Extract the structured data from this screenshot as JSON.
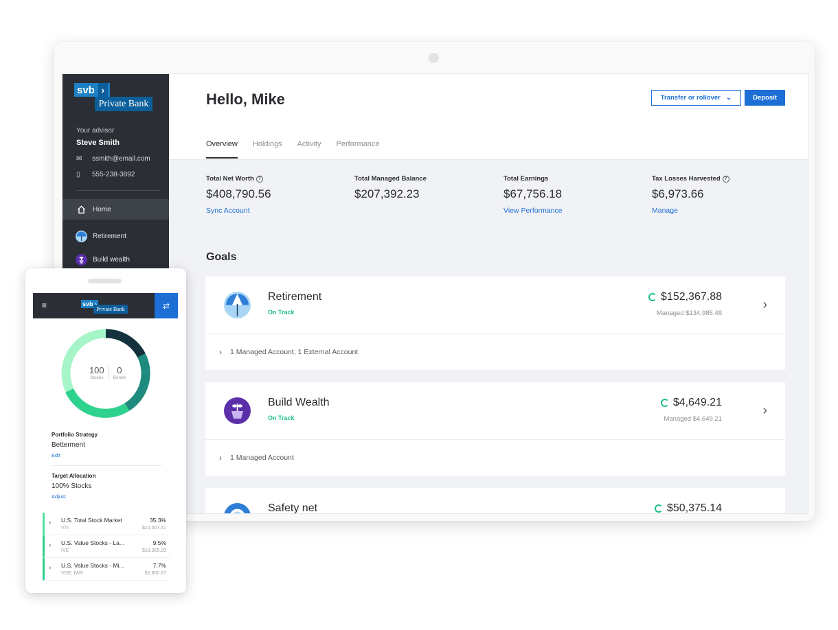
{
  "sidebar": {
    "logo_svb": "svb",
    "logo_private_bank": "Private Bank",
    "advisor_label": "Your advisor",
    "advisor_name": "Steve Smith",
    "email": "ssmith@email.com",
    "phone": "555-238-3892",
    "nav": [
      {
        "label": "Home",
        "icon": "home-icon",
        "active": true
      },
      {
        "label": "Retirement",
        "icon": "retirement-icon"
      },
      {
        "label": "Build wealth",
        "icon": "build-wealth-icon"
      }
    ]
  },
  "header": {
    "greeting": "Hello, Mike",
    "transfer_label": "Transfer or rollover",
    "deposit_label": "Deposit",
    "tabs": [
      "Overview",
      "Holdings",
      "Activity",
      "Performance"
    ]
  },
  "stats": [
    {
      "label": "Total Net Worth",
      "value": "$408,790.56",
      "link": "Sync Account",
      "help": true
    },
    {
      "label": "Total Managed Balance",
      "value": "$207,392.23",
      "link": ""
    },
    {
      "label": "Total Earnings",
      "value": "$67,756.18",
      "link": "View Performance"
    },
    {
      "label": "Tax Losses Harvested",
      "value": "$6,973.66",
      "link": "Manage",
      "help": true
    }
  ],
  "goals_title": "Goals",
  "goals": [
    {
      "name": "Retirement",
      "status": "On Track",
      "amount": "$152,367.88",
      "managed": "Managed $134,985.48",
      "accounts": "1 Managed Account, 1 External Account"
    },
    {
      "name": "Build Wealth",
      "status": "On Track",
      "amount": "$4,649.21",
      "managed": "Managed $4,649.21",
      "accounts": "1 Managed Account"
    },
    {
      "name": "Safety net",
      "status": "",
      "amount": "$50,375.14",
      "managed": "",
      "accounts": ""
    }
  ],
  "phone": {
    "logo_svb": "svb",
    "logo_private_bank": "Private Bank",
    "donut": {
      "stocks_value": "100",
      "stocks_label": "Stocks",
      "bonds_value": "0",
      "bonds_label": "Bonds",
      "colors": [
        "#14313d",
        "#1f8a7e",
        "#2fd18e",
        "#a6f5c8"
      ]
    },
    "portfolio_strategy_label": "Portfolio Strategy",
    "portfolio_strategy_value": "Betterment",
    "portfolio_strategy_link": "Edit",
    "target_allocation_label": "Target Allocation",
    "target_allocation_value": "100% Stocks",
    "target_allocation_link": "Adjust",
    "allocations": [
      {
        "name": "U.S. Total Stock Market",
        "ticker": "VTI",
        "pct": "35.3%",
        "value": "$10,507.41"
      },
      {
        "name": "U.S. Value Stocks - La...",
        "ticker": "IVE",
        "pct": "9.5%",
        "value": "$10,365.20"
      },
      {
        "name": "U.S. Value Stocks - Mi...",
        "ticker": "VOE, IWS",
        "pct": "7.7%",
        "value": "$2,800.67"
      }
    ]
  }
}
